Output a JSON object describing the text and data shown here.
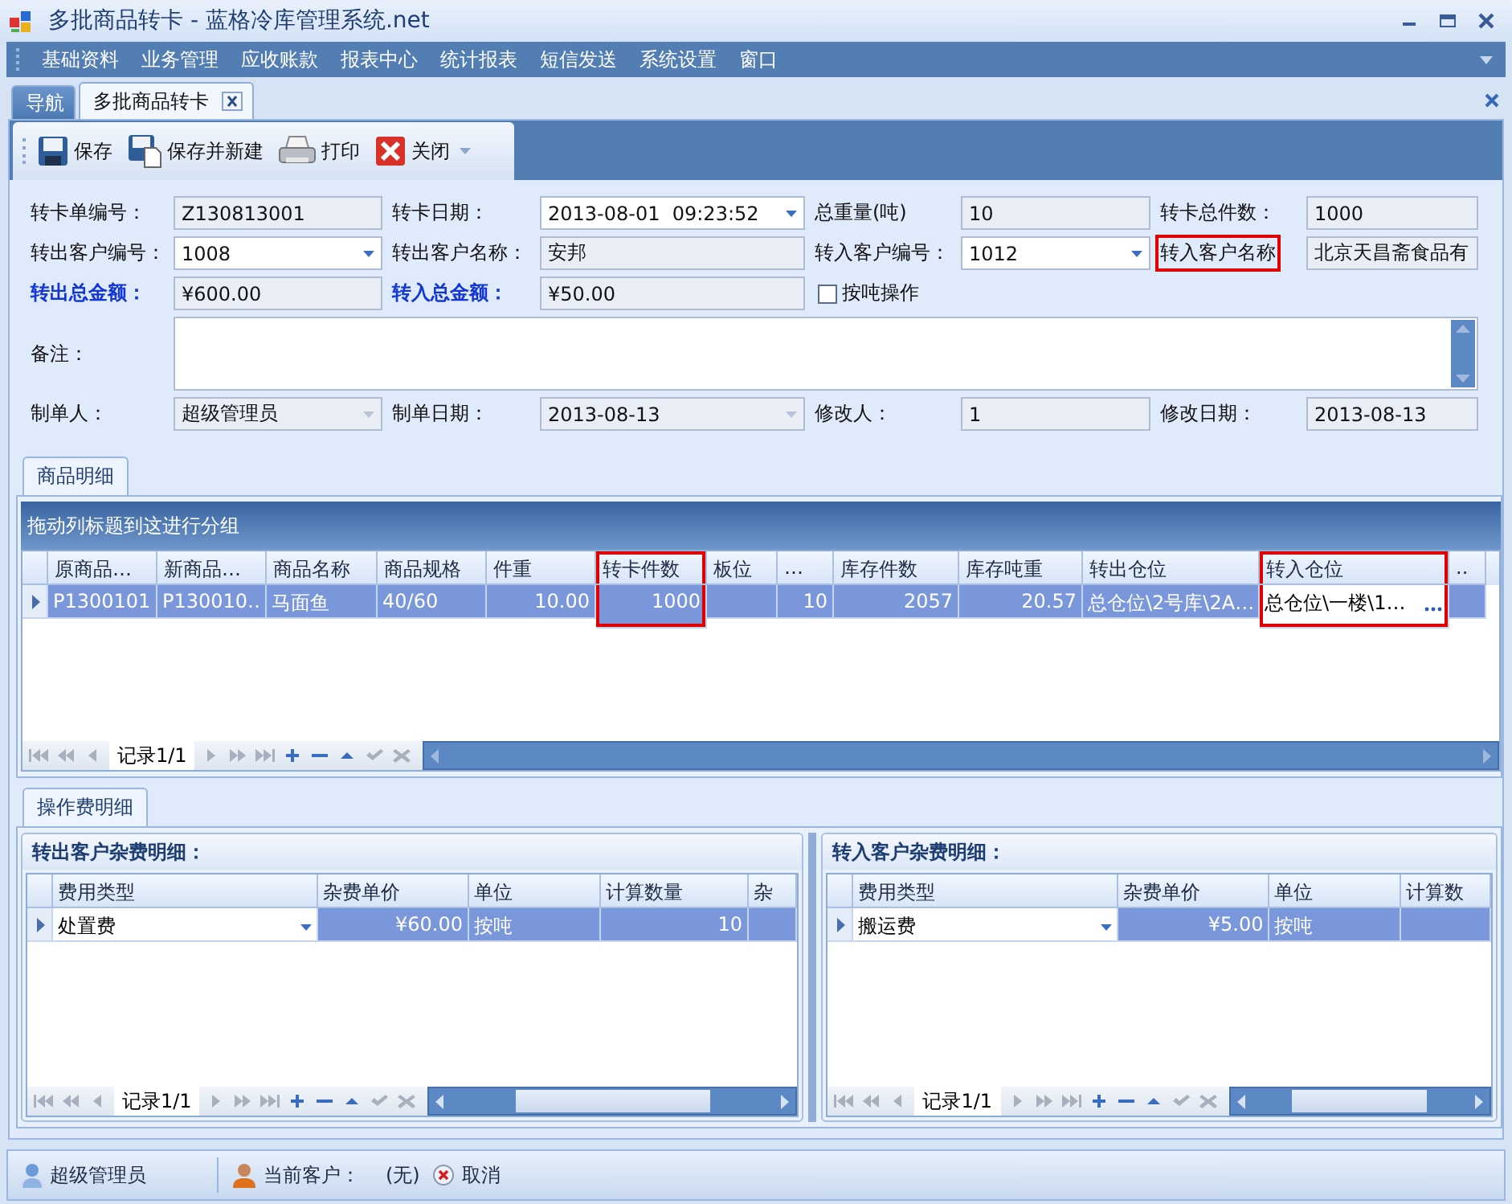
{
  "window": {
    "title": "多批商品转卡 - 蓝格冷库管理系统.net"
  },
  "menu": [
    "基础资料",
    "业务管理",
    "应收账款",
    "报表中心",
    "统计报表",
    "短信发送",
    "系统设置",
    "窗口"
  ],
  "tabs": [
    {
      "label": "导航",
      "selected": false,
      "closable": false
    },
    {
      "label": "多批商品转卡",
      "selected": true,
      "closable": true
    }
  ],
  "toolbar": [
    {
      "label": "保存",
      "kind": "save"
    },
    {
      "label": "保存并新建",
      "kind": "save-new"
    },
    {
      "label": "打印",
      "kind": "print"
    },
    {
      "label": "关闭",
      "kind": "close"
    }
  ],
  "form": {
    "rows": [
      [
        {
          "label": "转卡单编号：",
          "value": "Z130813001",
          "kind": "readonly",
          "emphasis": false,
          "highlighted": false
        },
        {
          "label": "转卡日期：",
          "value": "2013-08-01  09:23:52",
          "kind": "dropdown",
          "emphasis": false,
          "highlighted": false
        },
        {
          "label": "总重量(吨)",
          "value": "10",
          "kind": "readonly",
          "emphasis": false,
          "highlighted": false
        },
        {
          "label": "转卡总件数：",
          "value": "1000",
          "kind": "readonly",
          "emphasis": false,
          "highlighted": false
        }
      ],
      [
        {
          "label": "转出客户编号：",
          "value": "1008",
          "kind": "dropdown",
          "emphasis": false,
          "highlighted": false
        },
        {
          "label": "转出客户名称：",
          "value": "安邦",
          "kind": "readonly",
          "emphasis": false,
          "highlighted": false
        },
        {
          "label": "转入客户编号：",
          "value": "1012",
          "kind": "dropdown",
          "emphasis": false,
          "highlighted": false
        },
        {
          "label": "转入客户名称",
          "value": "北京天昌斋食品有",
          "kind": "readonly",
          "emphasis": false,
          "highlighted": true
        }
      ],
      [
        {
          "label": "转出总金额：",
          "value": "¥600.00",
          "kind": "readonly",
          "emphasis": true,
          "highlighted": false
        },
        {
          "label": "转入总金额：",
          "value": "¥50.00",
          "kind": "readonly",
          "emphasis": true,
          "highlighted": false
        },
        {
          "label": "按吨操作",
          "kind": "checkbox",
          "checked": false,
          "emphasis": false,
          "highlighted": false
        }
      ]
    ],
    "remarks": {
      "label": "备注："
    },
    "footer": [
      {
        "label": "制单人：",
        "value": "超级管理员",
        "kind": "dropdown-disabled",
        "emphasis": false,
        "highlighted": false
      },
      {
        "label": "制单日期：",
        "value": "2013-08-13",
        "kind": "dropdown-readonly",
        "emphasis": false,
        "highlighted": false
      },
      {
        "label": "修改人：",
        "value": "1",
        "kind": "readonly",
        "emphasis": false,
        "highlighted": false
      },
      {
        "label": "修改日期：",
        "value": "2013-08-13",
        "kind": "readonly",
        "emphasis": false,
        "highlighted": false
      }
    ]
  },
  "goods": {
    "tab": "商品明细",
    "group_hint": "拖动列标题到这进行分组",
    "columns": [
      {
        "label": "原商品…",
        "highlighted": false
      },
      {
        "label": "新商品…",
        "highlighted": false
      },
      {
        "label": "商品名称",
        "highlighted": false
      },
      {
        "label": "商品规格",
        "highlighted": false
      },
      {
        "label": "件重",
        "highlighted": false
      },
      {
        "label": "转卡件数",
        "highlighted": true
      },
      {
        "label": "板位",
        "highlighted": false
      },
      {
        "label": "…",
        "highlighted": false
      },
      {
        "label": "库存件数",
        "highlighted": false
      },
      {
        "label": "库存吨重",
        "highlighted": false
      },
      {
        "label": "转出仓位",
        "highlighted": false
      },
      {
        "label": "转入仓位",
        "highlighted": true
      },
      {
        "label": "..",
        "highlighted": false
      }
    ],
    "rows": [
      {
        "selected": true,
        "cells": [
          {
            "text": "P1300101"
          },
          {
            "text": "P130010…"
          },
          {
            "text": "马面鱼"
          },
          {
            "text": "40/60"
          },
          {
            "text": "10.00"
          },
          {
            "text": "1000"
          },
          {},
          {
            "text": "10"
          },
          {
            "text": "2057"
          },
          {
            "text": "20.57"
          },
          {
            "text": "总仓位\\2号库\\2A…"
          },
          {
            "text": "总仓位\\一楼\\1…",
            "kind": "ellipsis"
          },
          {}
        ]
      }
    ],
    "record": "记录1/1"
  },
  "fees": {
    "tab": "操作费明细",
    "panels": [
      {
        "title": "转出客户杂费明细：",
        "columns": [
          {
            "label": "费用类型"
          },
          {
            "label": "杂费单价"
          },
          {
            "label": "单位"
          },
          {
            "label": "计算数量"
          },
          {
            "label": "杂"
          }
        ],
        "rows": [
          {
            "selected": true,
            "cells": [
              {
                "text": "处置费",
                "kind": "dropdown"
              },
              {
                "text": "¥60.00"
              },
              {
                "text": "按吨"
              },
              {
                "text": "10"
              },
              {}
            ]
          }
        ],
        "record": "记录1/1"
      },
      {
        "title": "转入客户杂费明细：",
        "columns": [
          {
            "label": "费用类型"
          },
          {
            "label": "杂费单价"
          },
          {
            "label": "单位"
          },
          {
            "label": "计算数"
          }
        ],
        "rows": [
          {
            "selected": true,
            "cells": [
              {
                "text": "搬运费",
                "kind": "dropdown"
              },
              {
                "text": "¥5.00"
              },
              {
                "text": "按吨"
              },
              {}
            ]
          }
        ],
        "record": "记录1/1"
      }
    ]
  },
  "status_bar": {
    "user": "超级管理员",
    "customer_label": "当前客户：",
    "customer": "(无)",
    "cancel": "取消"
  }
}
